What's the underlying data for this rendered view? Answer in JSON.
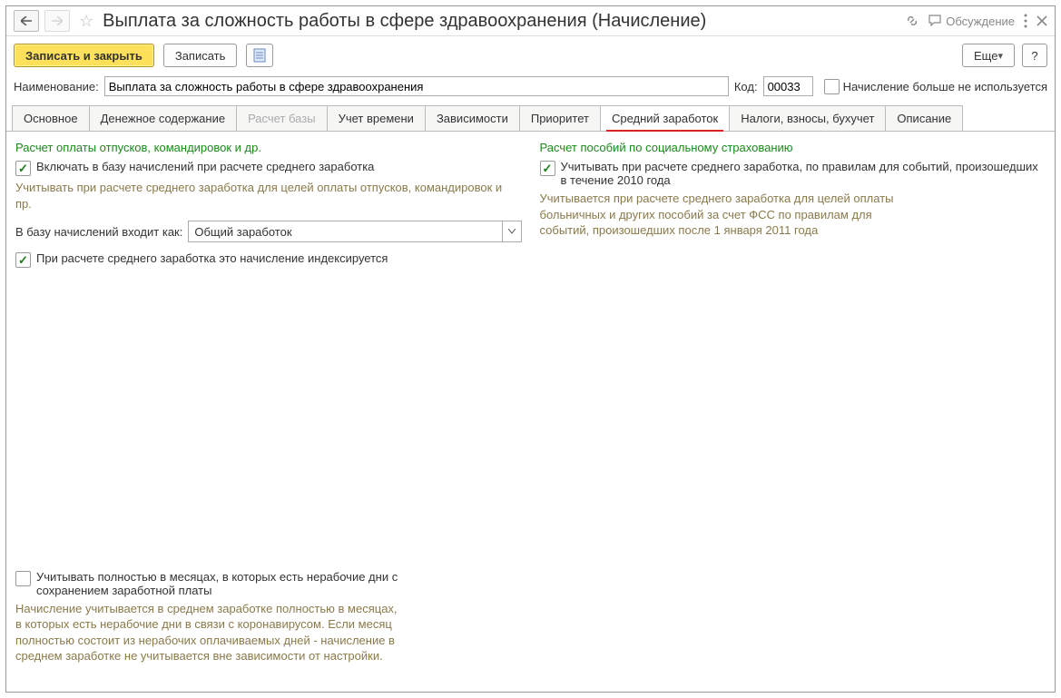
{
  "header": {
    "title": "Выплата за сложность работы в сфере здравоохранения (Начисление)",
    "discussion": "Обсуждение"
  },
  "toolbar": {
    "save_close": "Записать и закрыть",
    "save": "Записать",
    "more": "Еще",
    "help": "?"
  },
  "fields": {
    "name_label": "Наименование:",
    "name_value": "Выплата за сложность работы в сфере здравоохранения",
    "code_label": "Код:",
    "code_value": "00033",
    "not_used_label": "Начисление больше не используется"
  },
  "tabs": [
    "Основное",
    "Денежное содержание",
    "Расчет базы",
    "Учет времени",
    "Зависимости",
    "Приоритет",
    "Средний заработок",
    "Налоги, взносы, бухучет",
    "Описание"
  ],
  "left": {
    "section": "Расчет оплаты отпусков, командировок и др.",
    "chk1": "Включать в базу начислений при расчете среднего заработка",
    "hint1": "Учитывать при расчете среднего заработка для целей оплаты отпусков, командировок и пр.",
    "base_label": "В базу начислений входит как:",
    "base_value": "Общий заработок",
    "chk2": "При расчете среднего заработка это начисление индексируется",
    "chk3": "Учитывать полностью в месяцах, в которых есть нерабочие дни с сохранением заработной платы",
    "hint3": "Начисление учитывается в среднем заработке полностью в месяцах, в которых есть нерабочие дни в связи с коронавирусом. Если месяц полностью состоит из нерабочих оплачиваемых дней - начисление в среднем заработке не учитывается вне зависимости от настройки."
  },
  "right": {
    "section": "Расчет пособий по социальному страхованию",
    "chk1": "Учитывать при расчете среднего заработка, по правилам для событий, произошедших в течение 2010 года",
    "hint1": "Учитывается при расчете среднего заработка для целей оплаты больничных и других пособий за счет ФСС по правилам для событий, произошедших после 1 января 2011 года"
  }
}
